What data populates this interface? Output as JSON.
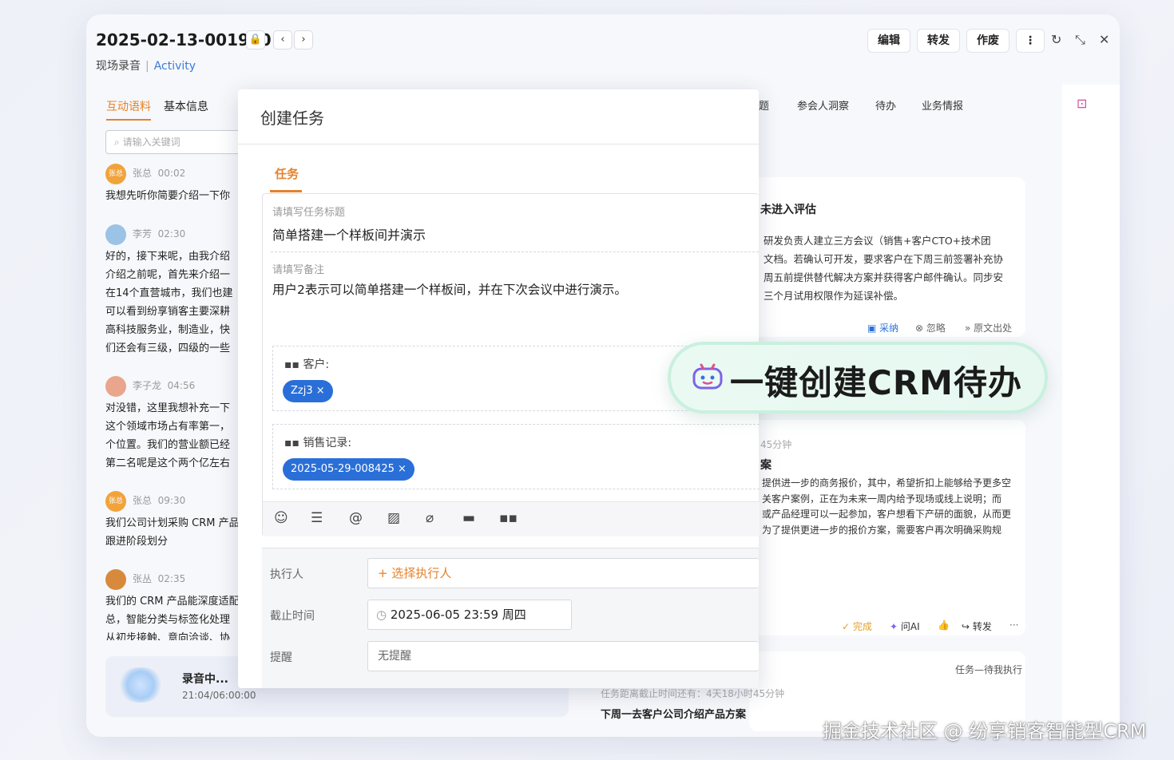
{
  "header": {
    "title": "2025-02-13-001960",
    "lock_icon": "🔒",
    "prev_icon": "‹",
    "next_icon": "›",
    "sub_left": "现场录音",
    "sub_sep": "|",
    "sub_right": "Activity",
    "edit": "编辑",
    "forward": "转发",
    "void": "作废",
    "more_icon": "⋮",
    "refresh_icon": "↻",
    "collapse_icon": "⤡",
    "close_icon": "✕"
  },
  "left": {
    "tab_active": "互动语料",
    "tab_other": "基本信息",
    "search_placeholder": "请输入关键词",
    "messages": [
      {
        "speaker": "张总",
        "time": "00:02",
        "avatar": "张总",
        "text": "我想先听你简要介绍一下你"
      },
      {
        "speaker": "李芳",
        "time": "02:30",
        "avatar": "",
        "text": "好的，接下来呢，由我介绍\n介绍之前呢，首先来介绍一\n在14个直营城市，我们也建\n可以看到纷享销客主要深耕\n高科技服务业，制造业，快\n们还会有三级，四级的一些"
      },
      {
        "speaker": "李子龙",
        "time": "04:56",
        "avatar": "",
        "text": "对没错，这里我想补充一下\n这个领域市场占有率第一，\n个位置。我们的营业额已经\n第二名呢是这个两个亿左右"
      },
      {
        "speaker": "张总",
        "time": "09:30",
        "avatar": "张总",
        "text": "我们公司计划采购 CRM 产品\n跟进阶段划分"
      },
      {
        "speaker": "张丛",
        "time": "02:35",
        "avatar": "",
        "text": "我们的 CRM 产品能深度适配\n总，智能分类与标签化处理\n从初步接触、意向洽谈、协"
      }
    ],
    "rec_title": "录音中...",
    "rec_time": "21:04/06:00:00"
  },
  "right": {
    "tabs": [
      "题",
      "参会人洞察",
      "待办",
      "业务情报"
    ],
    "card1_title": "未进入评估",
    "card1_text": "研发负责人建立三方会议（销售+客户CTO+技术团\n文档。若确认可开发，要求客户在下周三前签署补充协\n周五前提供替代解决方案并获得客户邮件确认。同步安\n三个月试用权限作为延误补偿。",
    "adopt": "采纳",
    "ignore": "忽略",
    "source": "原文出处",
    "card2_time": "45分钟",
    "card2_title": "案",
    "card2_text": "提供进一步的商务报价，其中，希望折扣上能够给予更多空\n关客户案例，正在为未来一周内给予现场或线上说明；而\n或产品经理可以一起参加，客户想看下产研的面貌，从而更\n为了提供更进一步的报价方案，需要客户再次明确采购规",
    "done": "完成",
    "ask_ai": "问AI",
    "fwd": "转发",
    "more": "···",
    "task_tag": "任务—待我执行",
    "deadline": "任务距离截止时间还有：4天18小时45分钟",
    "task_title": "下周一去客户公司介绍产品方案"
  },
  "modal": {
    "title": "创建任务",
    "tab": "任务",
    "title_ph": "请填写任务标题",
    "title_val": "简单搭建一个样板间并演示",
    "note_ph": "请填写备注",
    "note_val": "用户2表示可以简单搭建一个样板间，并在下次会议中进行演示。",
    "customer_label": "客户:",
    "customer_chip": "Zzj3 ×",
    "sales_label": "销售记录:",
    "sales_chip": "2025-05-29-008425 ×",
    "exec_label": "执行人",
    "exec_ph": "+ 选择执行人",
    "deadline_label": "截止时间",
    "deadline_val": "2025-06-05 23:59 周四",
    "remind_label": "提醒",
    "remind_val": "无提醒"
  },
  "banner": {
    "text": "一键创建CRM待办",
    "icon": "robot-icon"
  },
  "watermark": "掘金技术社区 @ 纷享销客智能型CRM",
  "colors": {
    "accent": "#e4822c",
    "chip_blue": "#2a6fd8",
    "link_blue": "#3d7bd6",
    "banner_bg": "#eafaf3"
  }
}
